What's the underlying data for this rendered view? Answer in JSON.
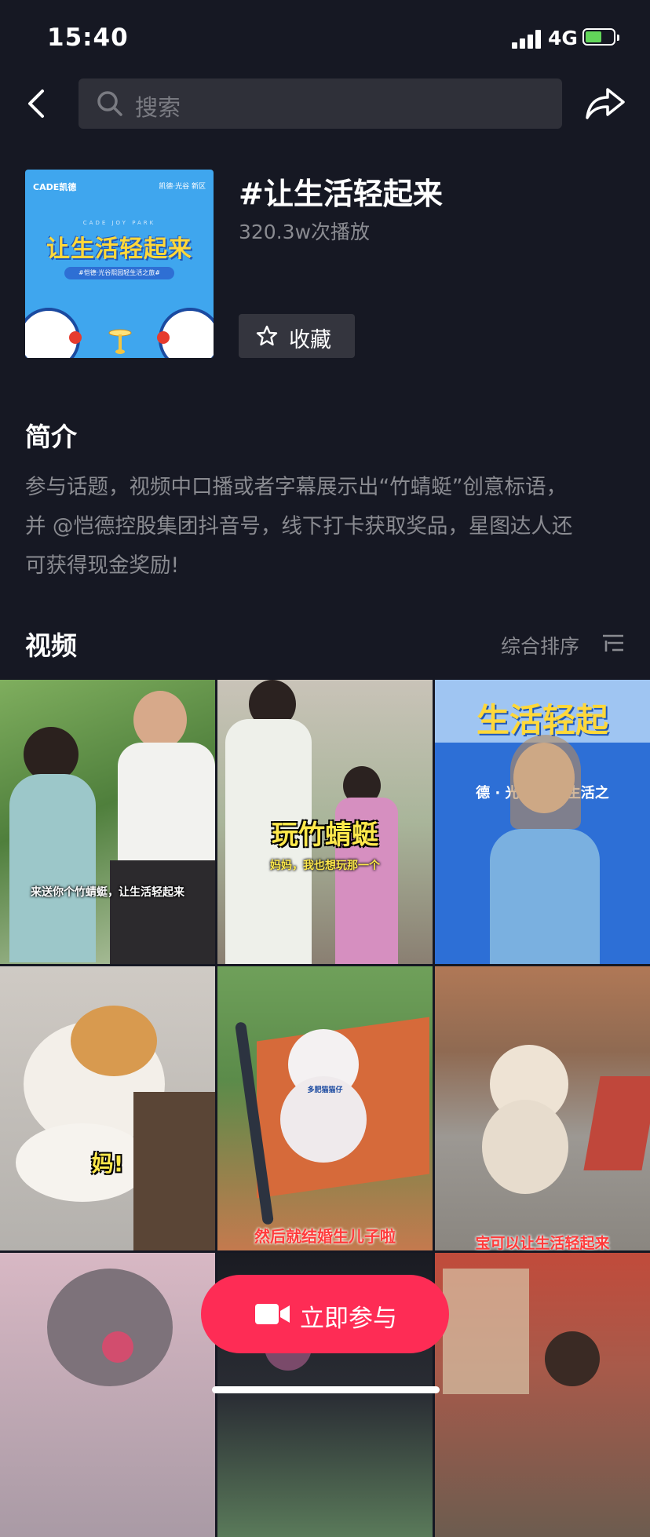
{
  "status_bar": {
    "time": "15:40",
    "network": "4G",
    "battery_level": 0.6
  },
  "search": {
    "placeholder": "搜索"
  },
  "topic": {
    "cover": {
      "brand": "CADE凯德",
      "brand_right": "凯德·光谷 新区",
      "subtitle": "CADE JOY PARK",
      "logo_text": "让生活轻起来",
      "tagline": "#恺德·光谷熙园轻生活之旅#"
    },
    "title": "#让生活轻起来",
    "plays": "320.3w次播放",
    "favorite_label": "收藏"
  },
  "intro": {
    "heading": "简介",
    "lines": [
      "参与话题，视频中口播或者字幕展示出“竹蜻蜓”创意标语，",
      "并 @恺德控股集团抖音号，线下打卡获取奖品，星图达人还",
      "可获得现金奖励!"
    ]
  },
  "videos": {
    "heading": "视频",
    "sort_label": "综合排序",
    "items": [
      {
        "caption": "来送你个竹蜻蜓，让生活轻起来"
      },
      {
        "caption": "玩竹蜻蜓",
        "caption2": "妈妈，我也想玩那一个"
      },
      {
        "caption": "生活轻起",
        "caption2": "德 · 光谷熙园 生活之"
      },
      {
        "caption": "妈!"
      },
      {
        "caption": "然后就结婚生儿子啦",
        "caption2": "多肥猫猫仔"
      },
      {
        "caption": "宝可以让生活轻起来"
      },
      {
        "caption": ""
      },
      {
        "caption": ""
      },
      {
        "caption": ""
      }
    ]
  },
  "join_button": {
    "label": "立即参与"
  }
}
